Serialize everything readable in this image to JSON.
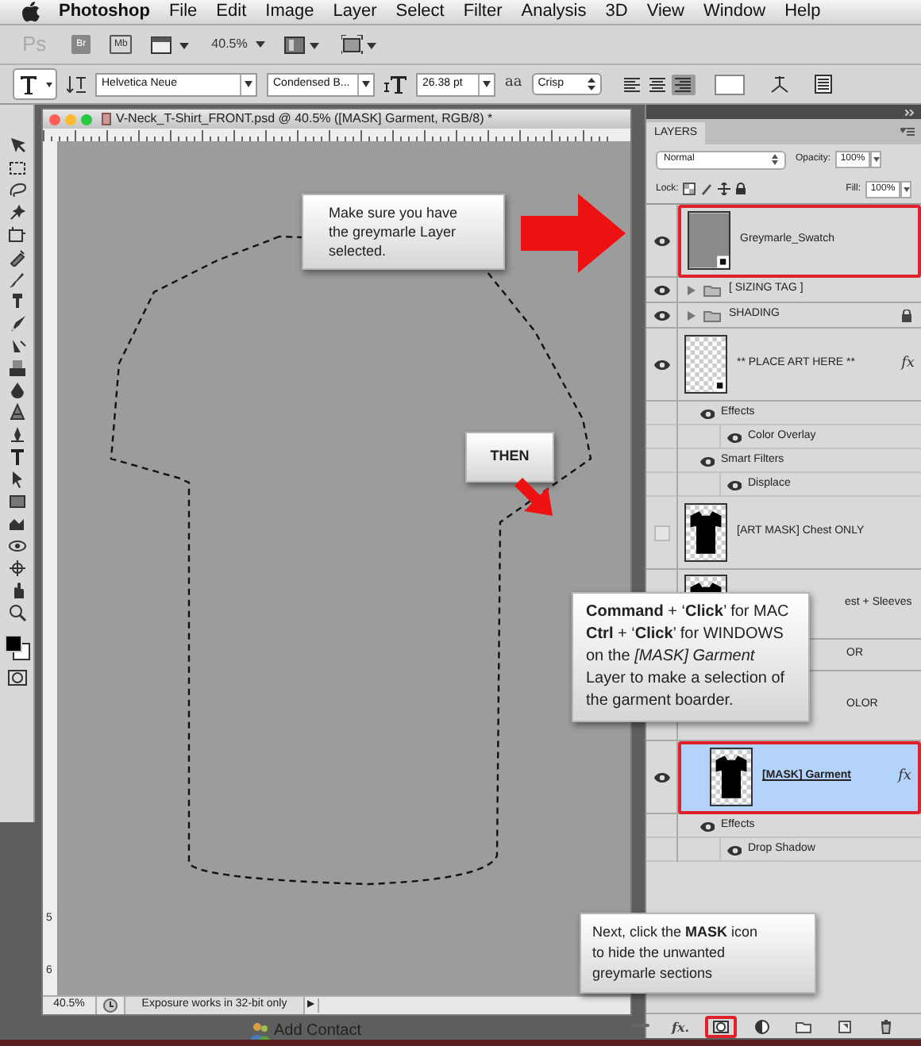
{
  "menu_bar": {
    "app": "Photoshop",
    "items": [
      "File",
      "Edit",
      "Image",
      "Layer",
      "Select",
      "Filter",
      "Analysis",
      "3D",
      "View",
      "Window",
      "Help"
    ]
  },
  "app_bar": {
    "logo": "Ps",
    "bridge": "Br",
    "mini_bridge": "Mb",
    "zoom": "40.5%"
  },
  "options_bar": {
    "font_family": "Helvetica Neue",
    "font_style": "Condensed B...",
    "font_size": "26.38 pt",
    "antialias_glyph": "aa",
    "antialias": "Crisp",
    "align": [
      {
        "selected": false
      },
      {
        "selected": false
      },
      {
        "selected": true
      }
    ]
  },
  "document": {
    "title": "V-Neck_T-Shirt_FRONT.psd @ 40.5% ([MASK] Garment, RGB/8) *",
    "ruler_labels": [
      "5",
      "6"
    ],
    "status_zoom": "40.5%",
    "status_text": "Exposure works in 32-bit only",
    "status_arrow": "▶"
  },
  "layers_panel": {
    "tab": "LAYERS",
    "blend_mode": "Normal",
    "opacity_label": "Opacity:",
    "opacity": "100%",
    "lock_label": "Lock:",
    "fill_label": "Fill:",
    "fill": "100%",
    "layers": [
      {
        "kind": "layer",
        "name": "Greymarle_Swatch",
        "thumbnail": {
          "kind": "grey"
        },
        "visible": true,
        "selected": false,
        "highlighted": true
      },
      {
        "kind": "group",
        "name": "[ SIZING TAG ]",
        "visible": true,
        "locked": false
      },
      {
        "kind": "group",
        "name": "SHADING",
        "visible": true,
        "locked": true
      },
      {
        "kind": "layer",
        "name": "** PLACE ART HERE **",
        "thumbnail": {
          "kind": "transparent"
        },
        "visible": true,
        "selected": false,
        "highlighted": false,
        "fx": "fx",
        "children": [
          {
            "kind": "effect",
            "name": "Effects",
            "children": [
              {
                "kind": "effect",
                "name": "Color Overlay"
              }
            ]
          },
          {
            "kind": "effect",
            "name": "Smart Filters",
            "children": [
              {
                "kind": "effect",
                "name": "Displace"
              }
            ]
          }
        ]
      },
      {
        "kind": "layer",
        "name": "[ART MASK] Chest ONLY",
        "thumbnail": {
          "kind": "shirt"
        },
        "visible": false,
        "selected": false,
        "highlighted": false
      },
      {
        "kind": "partial",
        "name": "est + Sleeves",
        "thumbnail": {
          "kind": "shirt"
        }
      },
      {
        "kind": "partial_short",
        "name": "OR"
      },
      {
        "kind": "partial",
        "name": "OLOR"
      },
      {
        "kind": "layer",
        "name": "[MASK] Garment",
        "thumbnail": {
          "kind": "shirt"
        },
        "visible": true,
        "selected": true,
        "highlighted": true,
        "fx": "fx",
        "children": [
          {
            "kind": "effect",
            "name": "Effects",
            "children": [
              {
                "kind": "effect",
                "name": "Drop Shadow"
              }
            ]
          }
        ]
      }
    ],
    "buttons": [
      {
        "kind": "link",
        "highlighted": false
      },
      {
        "kind": "fx",
        "label": "fx.",
        "highlighted": false
      },
      {
        "kind": "mask",
        "highlighted": true
      },
      {
        "kind": "adjust",
        "highlighted": false
      },
      {
        "kind": "folder",
        "highlighted": false
      },
      {
        "kind": "new",
        "highlighted": false
      },
      {
        "kind": "trash",
        "highlighted": false
      }
    ]
  },
  "callouts": [
    {
      "lines": [
        "Make sure you have",
        "the greymarle Layer",
        "selected."
      ]
    },
    {
      "lines": [
        "THEN"
      ]
    },
    {
      "lines": [
        "**Command** + ‘**Click**’ for MAC",
        "**Ctrl** + ‘**Click**’ for WINDOWS",
        "on the *[MASK] Garment*",
        "Layer to make a selection of",
        "the garment boarder."
      ]
    },
    {
      "lines": [
        "Next, click the **MASK** icon",
        "to hide the unwanted",
        "greymarle sections"
      ]
    }
  ],
  "taskbar": {
    "label": "Add Contact"
  }
}
